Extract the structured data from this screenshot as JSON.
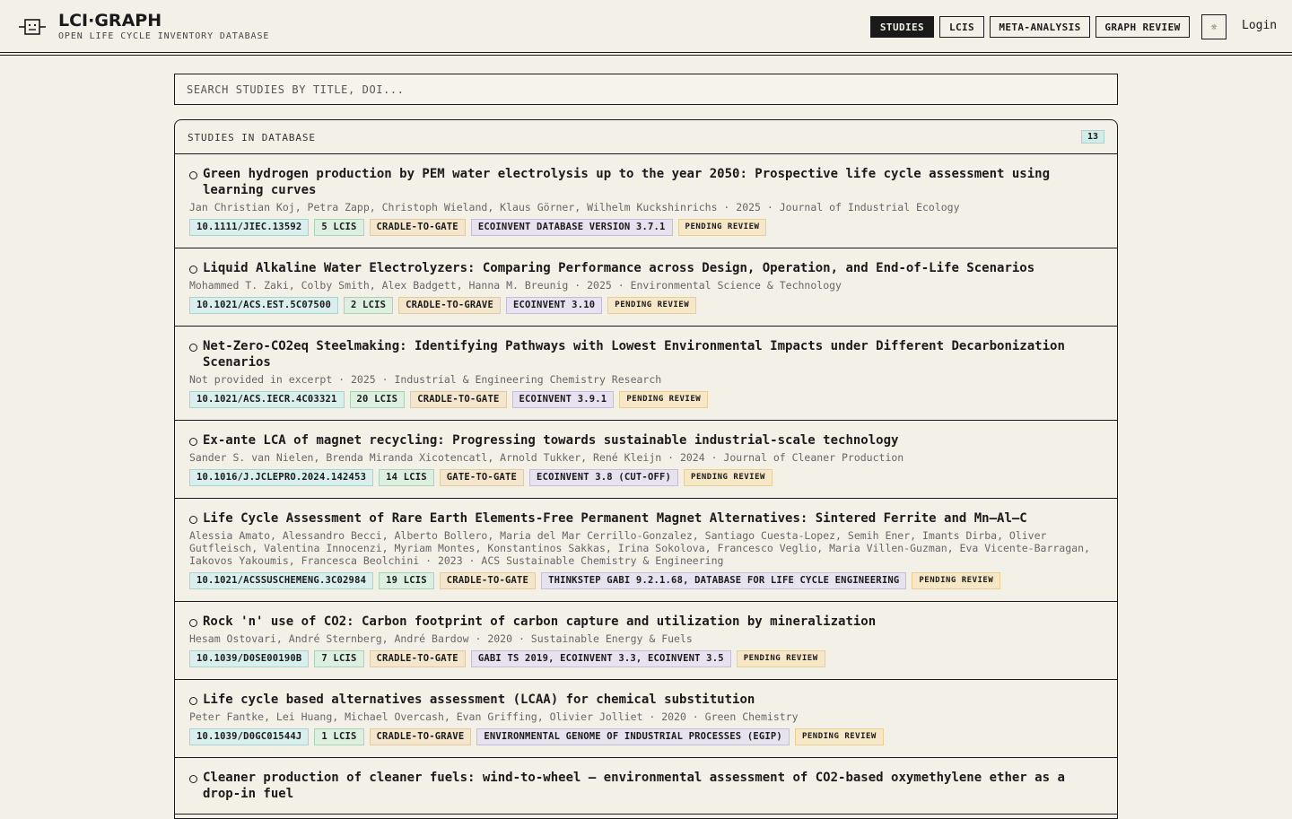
{
  "brand": {
    "title": "LCI·GRAPH",
    "subtitle": "OPEN LIFE CYCLE INVENTORY DATABASE",
    "icon": "robot-face-icon"
  },
  "nav": {
    "items": [
      {
        "label": "STUDIES",
        "active": true
      },
      {
        "label": "LCIS",
        "active": false
      },
      {
        "label": "META-ANALYSIS",
        "active": false
      },
      {
        "label": "GRAPH REVIEW",
        "active": false
      }
    ],
    "theme_icon": "sun-icon",
    "theme_glyph": "☼",
    "login_label": "Login"
  },
  "search": {
    "placeholder": "SEARCH STUDIES BY TITLE, DOI..."
  },
  "panel": {
    "title": "STUDIES IN DATABASE",
    "count": "13"
  },
  "studies": [
    {
      "title": "Green hydrogen production by PEM water electrolysis up to the year 2050: Prospective life cycle assessment using learning curves",
      "meta": "Jan Christian Koj, Petra Zapp, Christoph Wieland, Klaus Görner, Wilhelm Kuckshinrichs · 2025 · Journal of Industrial Ecology",
      "doi": "10.1111/JIEC.13592",
      "lcis": "5 LCIS",
      "scope": "CRADLE-TO-GATE",
      "database": "ECOINVENT DATABASE VERSION 3.7.1",
      "status": "PENDING REVIEW"
    },
    {
      "title": "Liquid Alkaline Water Electrolyzers: Comparing Performance across Design, Operation, and End-of-Life Scenarios",
      "meta": "Mohammed T. Zaki, Colby Smith, Alex Badgett, Hanna M. Breunig · 2025 · Environmental Science & Technology",
      "doi": "10.1021/ACS.EST.5C07500",
      "lcis": "2 LCIS",
      "scope": "CRADLE-TO-GRAVE",
      "database": "ECOINVENT 3.10",
      "status": "PENDING REVIEW"
    },
    {
      "title": "Net-Zero-CO2eq Steelmaking: Identifying Pathways with Lowest Environmental Impacts under Different Decarbonization Scenarios",
      "meta": "Not provided in excerpt · 2025 · Industrial & Engineering Chemistry Research",
      "doi": "10.1021/ACS.IECR.4C03321",
      "lcis": "20 LCIS",
      "scope": "CRADLE-TO-GATE",
      "database": "ECOINVENT 3.9.1",
      "status": "PENDING REVIEW"
    },
    {
      "title": "Ex-ante LCA of magnet recycling: Progressing towards sustainable industrial-scale technology",
      "meta": "Sander S. van Nielen, Brenda Miranda Xicotencatl, Arnold Tukker, René Kleijn · 2024 · Journal of Cleaner Production",
      "doi": "10.1016/J.JCLEPRO.2024.142453",
      "lcis": "14 LCIS",
      "scope": "GATE-TO-GATE",
      "database": "ECOINVENT 3.8 (CUT-OFF)",
      "status": "PENDING REVIEW"
    },
    {
      "title": "Life Cycle Assessment of Rare Earth Elements-Free Permanent Magnet Alternatives: Sintered Ferrite and Mn–Al–C",
      "meta": "Alessia Amato, Alessandro Becci, Alberto Bollero, Maria del Mar Cerrillo-Gonzalez, Santiago Cuesta-Lopez, Semih Ener, Imants Dirba, Oliver Gutfleisch, Valentina Innocenzi, Myriam Montes, Konstantinos Sakkas, Irina Sokolova, Francesco Veglio, Maria Villen-Guzman, Eva Vicente-Barragan, Iakovos Yakoumis, Francesca Beolchini · 2023 · ACS Sustainable Chemistry & Engineering",
      "doi": "10.1021/ACSSUSCHEMENG.3C02984",
      "lcis": "19 LCIS",
      "scope": "CRADLE-TO-GATE",
      "database": "THINKSTEP GABI 9.2.1.68, DATABASE FOR LIFE CYCLE ENGINEERING",
      "status": "PENDING REVIEW"
    },
    {
      "title": "Rock 'n' use of CO2: Carbon footprint of carbon capture and utilization by mineralization",
      "meta": "Hesam Ostovari, André Sternberg, André Bardow · 2020 · Sustainable Energy & Fuels",
      "doi": "10.1039/D0SE00190B",
      "lcis": "7 LCIS",
      "scope": "CRADLE-TO-GATE",
      "database": "GABI TS 2019, ECOINVENT 3.3, ECOINVENT 3.5",
      "status": "PENDING REVIEW"
    },
    {
      "title": "Life cycle based alternatives assessment (LCAA) for chemical substitution",
      "meta": "Peter Fantke, Lei Huang, Michael Overcash, Evan Griffing, Olivier Jolliet · 2020 · Green Chemistry",
      "doi": "10.1039/D0GC01544J",
      "lcis": "1 LCIS",
      "scope": "CRADLE-TO-GRAVE",
      "database": "ENVIRONMENTAL GENOME OF INDUSTRIAL PROCESSES (EGIP)",
      "status": "PENDING REVIEW"
    },
    {
      "title": "Cleaner production of cleaner fuels: wind-to-wheel – environmental assessment of CO2-based oxymethylene ether as a drop-in fuel",
      "meta": "",
      "doi": "",
      "lcis": "",
      "scope": "",
      "database": "",
      "status": ""
    }
  ]
}
